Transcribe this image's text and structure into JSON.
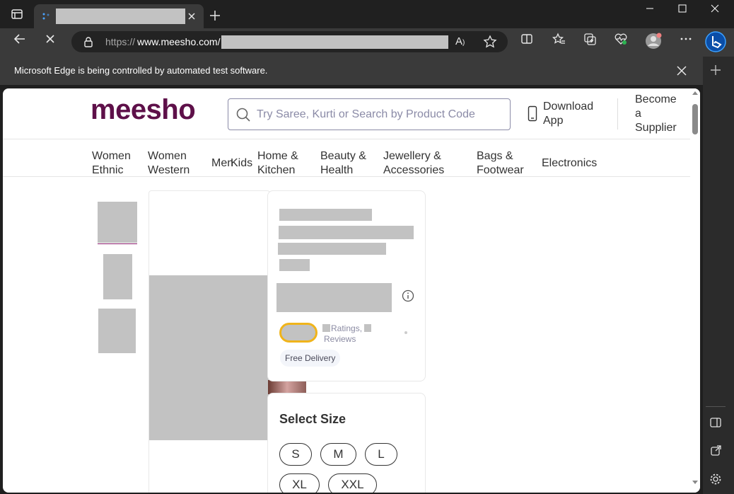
{
  "browser": {
    "tab_title": "",
    "url_prefix": "https://",
    "url_host": "www.meesho.com/",
    "infobar_text": "Microsoft Edge is being controlled by automated test software.",
    "icons": [
      "tab-actions-icon",
      "loading-icon",
      "close-tab-icon",
      "new-tab-icon",
      "minimize-icon",
      "maximize-icon",
      "window-close-icon",
      "back-icon",
      "stop-icon",
      "lock-icon",
      "read-aloud-icon",
      "favorite-icon",
      "split-screen-icon",
      "favorites-icon",
      "collections-icon",
      "health-icon",
      "profile-icon",
      "more-icon",
      "copilot-icon"
    ]
  },
  "site": {
    "logo": "meesho",
    "search_placeholder": "Try Saree, Kurti or Search by Product Code",
    "download_app": [
      "Download",
      "App"
    ],
    "become_supplier": [
      "Become",
      "a",
      "Supplier"
    ],
    "nav": [
      [
        "Women",
        "Ethnic"
      ],
      [
        "Women",
        "Western"
      ],
      [
        "Men"
      ],
      [
        "Kids"
      ],
      [
        "Home &",
        "Kitchen"
      ],
      [
        "Beauty &",
        "Health"
      ],
      [
        "Jewellery &",
        "Accessories"
      ],
      [
        "Bags &",
        "Footwear"
      ],
      [
        "Electronics"
      ]
    ]
  },
  "product": {
    "ratings_label": "Ratings,",
    "reviews_label": "Reviews",
    "free_delivery": "Free Delivery",
    "select_size_title": "Select Size",
    "sizes": [
      "S",
      "M",
      "L",
      "XL",
      "XXL"
    ]
  },
  "colors": {
    "brand": "#5e1049",
    "rating_border": "#f0b41b",
    "chrome_dark": "#202020",
    "chrome_mid": "#3a3a3a"
  }
}
